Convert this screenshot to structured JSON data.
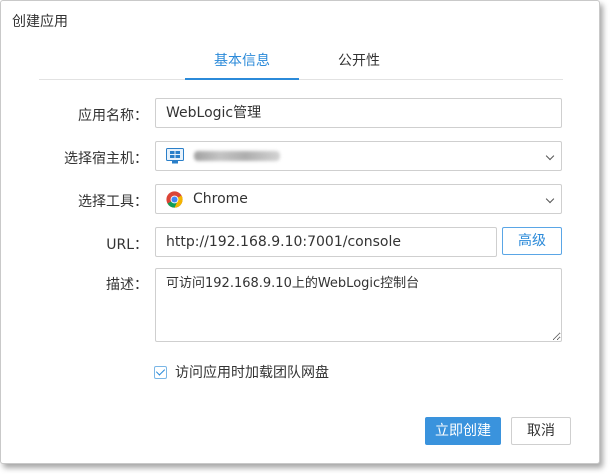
{
  "dialog": {
    "title": "创建应用",
    "tabs": [
      {
        "label": "基本信息",
        "active": true
      },
      {
        "label": "公开性",
        "active": false
      }
    ]
  },
  "form": {
    "app_name": {
      "label": "应用名称：",
      "value": "WebLogic管理"
    },
    "host": {
      "label": "选择宿主机：",
      "value_obscured": true
    },
    "tool": {
      "label": "选择工具：",
      "value": "Chrome"
    },
    "url": {
      "label": "URL：",
      "value": "http://192.168.9.10:7001/console",
      "advanced_label": "高级"
    },
    "description": {
      "label": "描述：",
      "value": "可访问192.168.9.10上的WebLogic控制台"
    },
    "mount_checkbox": {
      "label": "访问应用时加载团队网盘",
      "checked": true
    }
  },
  "footer": {
    "create_label": "立即创建",
    "cancel_label": "取消"
  },
  "colors": {
    "accent": "#2b8ad9",
    "primary_button": "#3a93dd"
  },
  "icons": {
    "host": "windows-monitor-icon",
    "tool": "chrome-icon"
  }
}
